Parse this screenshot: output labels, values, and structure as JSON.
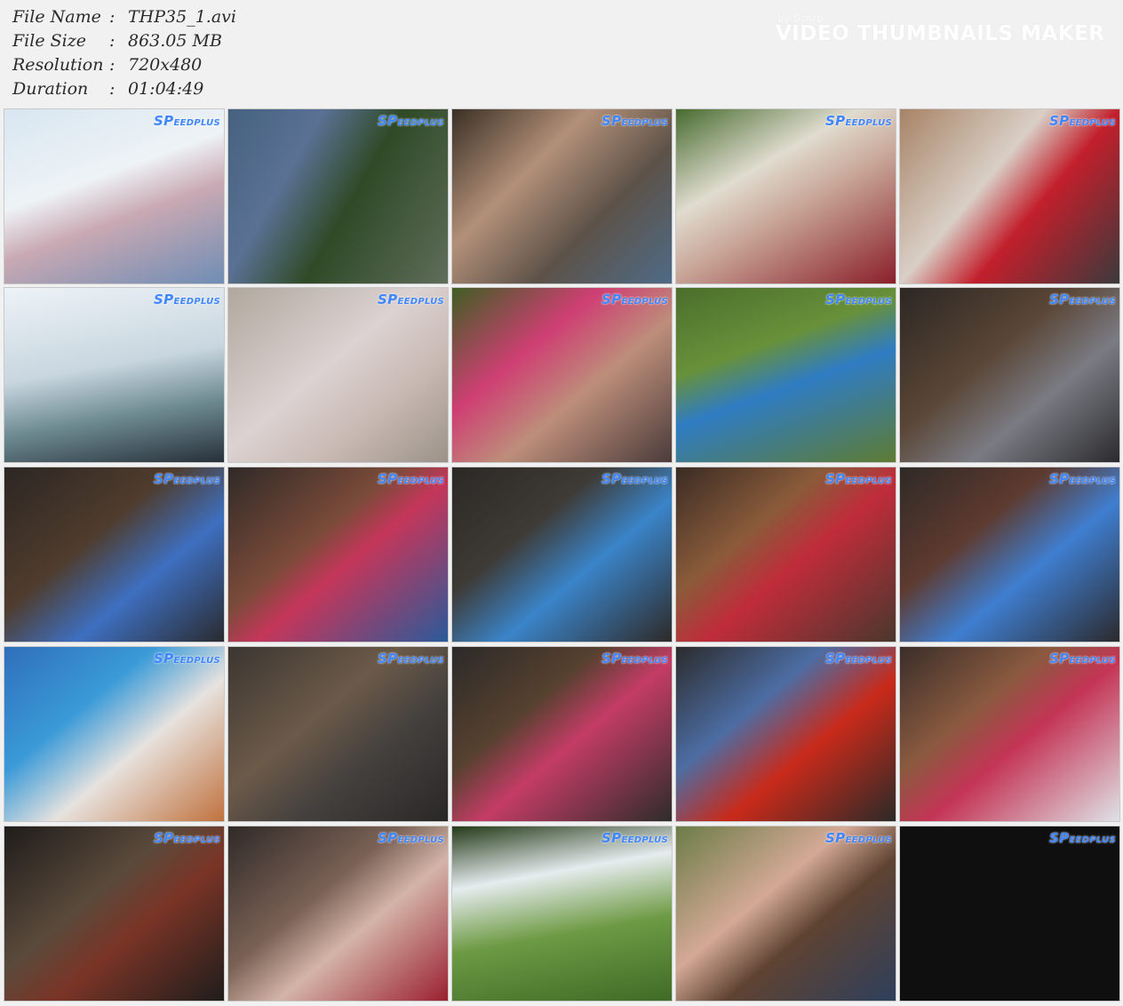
{
  "file_info": [
    {
      "label": "File Name",
      "value": "THP35_1.avi"
    },
    {
      "label": "File Size",
      "value": "863.05 MB"
    },
    {
      "label": "Resolution",
      "value": "720x480"
    },
    {
      "label": "Duration",
      "value": "01:04:49"
    }
  ],
  "separator": ":",
  "watermark": {
    "by": "by Scorp",
    "title": "VIDEO THUMBNAILS MAKER"
  },
  "thumbnail_logo": {
    "mark": "SP",
    "rest": "EEDPLUS"
  },
  "thumbnails": [
    {
      "bg": "linear-gradient(160deg,#d8e6f1 0%,#eef3f6 40%,#c9a9b3 60%,#6f8db4 100%)"
    },
    {
      "bg": "linear-gradient(120deg,#46617f 0%,#5a7194 30%,#2f4a27 55%,#5f6d5a 100%)"
    },
    {
      "bg": "linear-gradient(135deg,#3a3025 0%,#b39079 35%,#5d5248 65%,#4e6b87 100%)"
    },
    {
      "bg": "linear-gradient(150deg,#476b2f 0%,#e0dccf 35%,#c9a89a 55%,#8a1f2a 100%)"
    },
    {
      "bg": "linear-gradient(130deg,#a78366 0%,#d9cfc6 40%,#c21f2b 60%,#3b3a3c 100%)"
    },
    {
      "bg": "linear-gradient(170deg,#edf3f7 0%,#c8d6df 45%,#6e8b92 70%,#27303a 100%)"
    },
    {
      "bg": "linear-gradient(140deg,#b0a79d 0%,#dcd2d2 45%,#c8b9b2 70%,#9b9288 100%)"
    },
    {
      "bg": "linear-gradient(140deg,#3f5e23 0%,#cf3f73 35%,#bd8e7a 60%,#4a3b3a 100%)"
    },
    {
      "bg": "linear-gradient(160deg,#4b6e2c 0%,#68913a 35%,#2f7cc3 55%,#5e7c33 100%)"
    },
    {
      "bg": "linear-gradient(140deg,#2c2724 0%,#5a4636 40%,#7a7b83 65%,#2b2b2e 100%)"
    },
    {
      "bg": "linear-gradient(140deg,#2c2623 0%,#4f3c2d 40%,#3e6fc0 65%,#2a2b2f 100%)"
    },
    {
      "bg": "linear-gradient(140deg,#2f2a28 0%,#7b4b39 40%,#c5365a 55%,#2a5a9a 100%)"
    },
    {
      "bg": "linear-gradient(140deg,#2b2926 0%,#3e3a35 35%,#3a84c9 60%,#2e2a28 100%)"
    },
    {
      "bg": "linear-gradient(140deg,#3a2c24 0%,#8a5b3a 35%,#c02c3a 55%,#4a372d 100%)"
    },
    {
      "bg": "linear-gradient(140deg,#2f2a27 0%,#5e3a2f 35%,#3f7ed0 60%,#2b2a2d 100%)"
    },
    {
      "bg": "linear-gradient(140deg,#2f6fba 0%,#3a9ad8 35%,#e7e2de 60%,#c0723e 100%)"
    },
    {
      "bg": "linear-gradient(140deg,#3b3631 0%,#6c5a49 40%,#43403d 65%,#2a2827 100%)"
    },
    {
      "bg": "linear-gradient(140deg,#2b2a29 0%,#57412f 35%,#c43c66 55%,#2d2c2b 100%)"
    },
    {
      "bg": "linear-gradient(140deg,#2c2b2c 0%,#4c6da3 35%,#c92a1a 60%,#2b2a28 100%)"
    },
    {
      "bg": "linear-gradient(140deg,#3a2e2a 0%,#8a5a3f 35%,#c43455 55%,#dfe2e6 100%)"
    },
    {
      "bg": "linear-gradient(140deg,#1f1c1b 0%,#5a4a3b 40%,#7a3426 60%,#1f1d1c 100%)"
    },
    {
      "bg": "linear-gradient(140deg,#2f2a28 0%,#7a6155 40%,#d4b4a8 60%,#9a2030 100%)"
    },
    {
      "bg": "linear-gradient(170deg,#243a18 0%,#e6ecef 30%,#6d9a43 60%,#3f6b27 100%)"
    },
    {
      "bg": "linear-gradient(140deg,#6b7c47 0%,#d4a996 40%,#5f4332 60%,#2e3f5c 100%)"
    },
    {
      "bg": "#0f0f0f"
    }
  ]
}
